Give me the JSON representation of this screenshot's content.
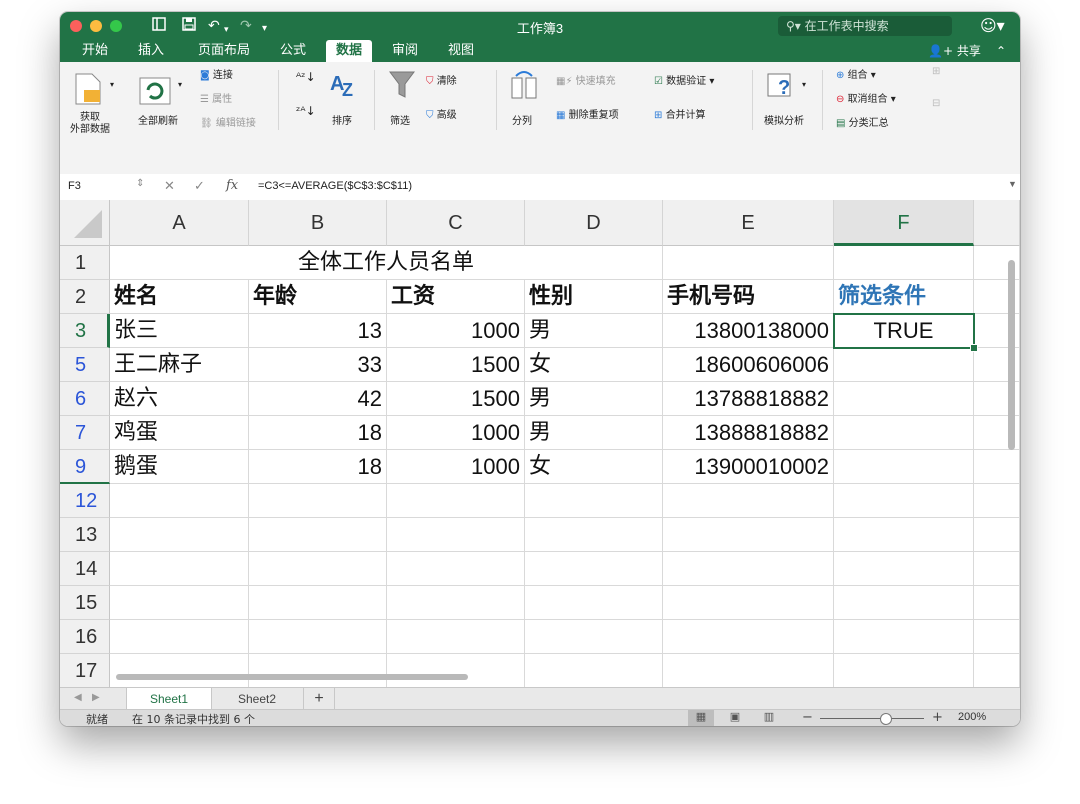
{
  "window": {
    "title": "工作簿3"
  },
  "titlebar": {
    "search_placeholder": "在工作表中搜索",
    "search_icon": "search-icon",
    "account_icon": "smiley-icon"
  },
  "tabs": [
    "开始",
    "插入",
    "页面布局",
    "公式",
    "数据",
    "审阅",
    "视图"
  ],
  "active_tab": "数据",
  "share_label": "共享",
  "ribbon": {
    "get_external": "获取\n外部数据",
    "refresh_all": "全部刷新",
    "connections": "连接",
    "properties": "属性",
    "edit_links": "编辑链接",
    "sort": "排序",
    "filter": "筛选",
    "clear": "清除",
    "advanced": "高级",
    "text_to_columns": "分列",
    "flash_fill": "快速填充",
    "remove_duplicates": "删除重复项",
    "data_validation": "数据验证",
    "consolidate": "合并计算",
    "what_if": "模拟分析",
    "group": "组合",
    "ungroup": "取消组合",
    "subtotal": "分类汇总"
  },
  "formula_bar": {
    "name_box": "F3",
    "formula": "=C3<=AVERAGE($C$3:$C$11)"
  },
  "columns": [
    "A",
    "B",
    "C",
    "D",
    "E",
    "F"
  ],
  "selected_column": "F",
  "sheet": {
    "title": "全体工作人员名单",
    "headers": [
      "姓名",
      "年龄",
      "工资",
      "性别",
      "手机号码",
      "筛选条件"
    ],
    "rows": [
      {
        "num": "3",
        "name": "张三",
        "age": "13",
        "salary": "1000",
        "gender": "男",
        "phone": "13800138000",
        "criteria": "TRUE"
      },
      {
        "num": "5",
        "name": "王二麻子",
        "age": "33",
        "salary": "1500",
        "gender": "女",
        "phone": "18600606006",
        "criteria": ""
      },
      {
        "num": "6",
        "name": "赵六",
        "age": "42",
        "salary": "1500",
        "gender": "男",
        "phone": "13788818882",
        "criteria": ""
      },
      {
        "num": "7",
        "name": "鸡蛋",
        "age": "18",
        "salary": "1000",
        "gender": "男",
        "phone": "13888818882",
        "criteria": ""
      },
      {
        "num": "9",
        "name": "鹅蛋",
        "age": "18",
        "salary": "1000",
        "gender": "女",
        "phone": "13900010002",
        "criteria": ""
      }
    ],
    "empty_rows": [
      "12",
      "13",
      "14",
      "15",
      "16",
      "17"
    ],
    "row_labels": {
      "r1": "1",
      "r2": "2"
    }
  },
  "sheet_tabs": [
    "Sheet1",
    "Sheet2"
  ],
  "active_sheet": "Sheet1",
  "status": {
    "ready": "就绪",
    "filter_result": "在 10 条记录中找到 6 个",
    "zoom": "200%"
  },
  "colors": {
    "excel_green": "#217346",
    "filtered_row_blue": "#2b55d8",
    "criteria_header_blue": "#2e75b6"
  }
}
